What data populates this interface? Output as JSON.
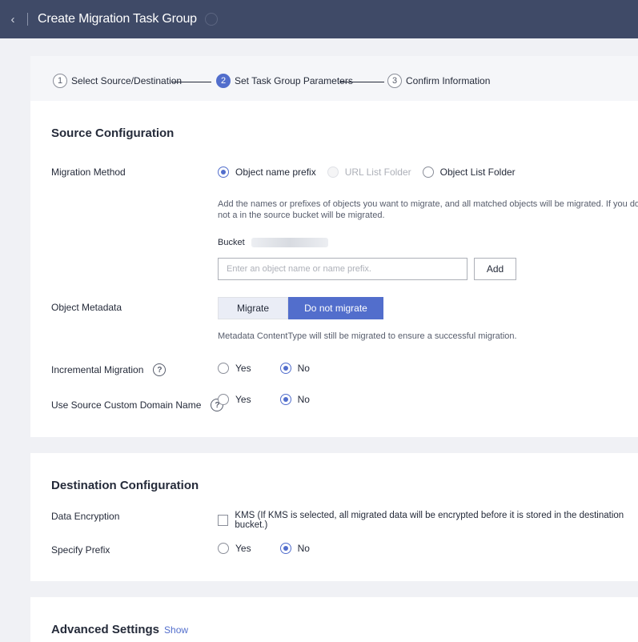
{
  "header": {
    "title": "Create Migration Task Group"
  },
  "steps": [
    {
      "num": "1",
      "label": "Select Source/Destination"
    },
    {
      "num": "2",
      "label": "Set Task Group Parameters"
    },
    {
      "num": "3",
      "label": "Confirm Information"
    }
  ],
  "source": {
    "title": "Source Configuration",
    "migration_method": {
      "label": "Migration Method",
      "options": [
        "Object name prefix",
        "URL List Folder",
        "Object List Folder"
      ],
      "hint": "Add the names or prefixes of objects you want to migrate, and all matched objects will be migrated. If you do not a in the source bucket will be migrated.",
      "bucket_label": "Bucket",
      "input_placeholder": "Enter an object name or name prefix.",
      "add_label": "Add"
    },
    "object_metadata": {
      "label": "Object Metadata",
      "options": [
        "Migrate",
        "Do not migrate"
      ],
      "hint": "Metadata ContentType will still be migrated to ensure a successful migration."
    },
    "incremental": {
      "label": "Incremental Migration",
      "yes": "Yes",
      "no": "No"
    },
    "custom_domain": {
      "label": "Use Source Custom Domain Name",
      "yes": "Yes",
      "no": "No"
    }
  },
  "destination": {
    "title": "Destination Configuration",
    "encryption": {
      "label": "Data Encryption",
      "text": "KMS (If KMS is selected, all migrated data will be encrypted before it is stored in the destination bucket.)"
    },
    "prefix": {
      "label": "Specify Prefix",
      "yes": "Yes",
      "no": "No"
    }
  },
  "advanced": {
    "title": "Advanced Settings",
    "link": "Show"
  },
  "colors": {
    "header_bg": "#3f4a67",
    "accent": "#526ecc",
    "page_bg": "#f0f1f5"
  }
}
